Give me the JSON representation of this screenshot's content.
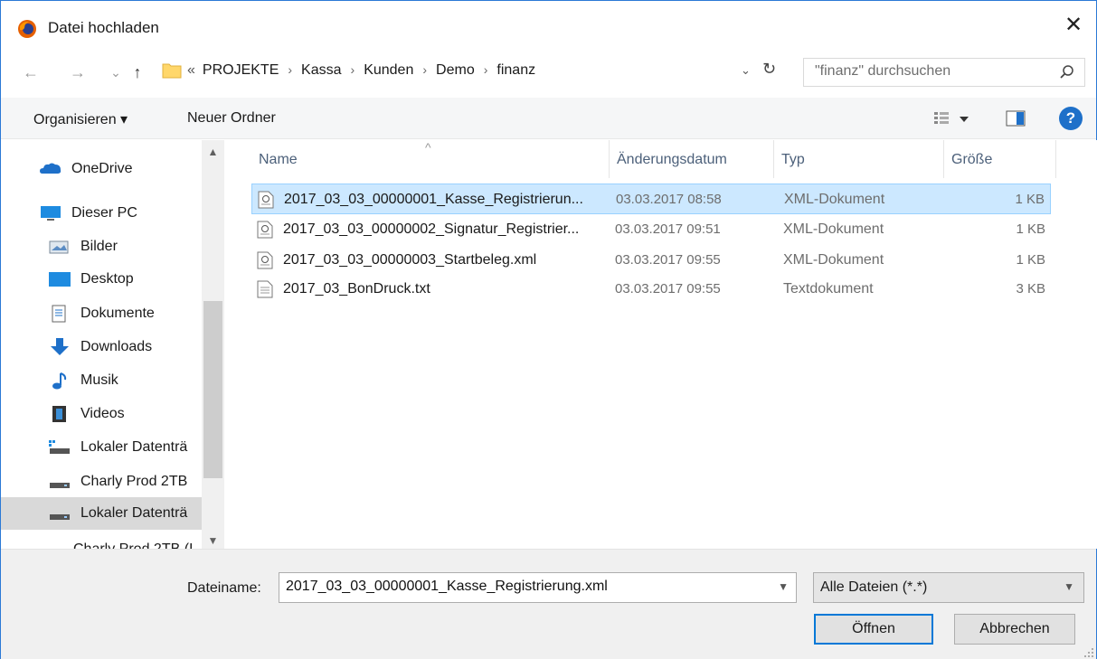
{
  "window": {
    "title": "Datei hochladen",
    "close_glyph": "✕",
    "app_icon": "firefox-icon"
  },
  "nav": {
    "back_glyph": "←",
    "forward_glyph": "→",
    "recent_glyph": "⌄",
    "up_glyph": "↑",
    "overflow_glyph": "«",
    "path": [
      "PROJEKTE",
      "Kassa",
      "Kunden",
      "Demo",
      "finanz"
    ],
    "path_sep": "›",
    "dropdown_glyph": "⌄",
    "refresh_glyph": "↻",
    "search_placeholder": "\"finanz\" durchsuchen"
  },
  "toolbar": {
    "organize_label": "Organisieren ▾",
    "new_folder_label": "Neuer Ordner",
    "help_label": "?"
  },
  "sidebar": {
    "items": [
      {
        "label": "OneDrive",
        "icon": "onedrive-icon"
      },
      {
        "label": "Dieser PC",
        "icon": "computer-icon"
      },
      {
        "label": "Bilder",
        "icon": "pictures-icon"
      },
      {
        "label": "Desktop",
        "icon": "desktop-icon"
      },
      {
        "label": "Dokumente",
        "icon": "documents-icon"
      },
      {
        "label": "Downloads",
        "icon": "downloads-icon"
      },
      {
        "label": "Musik",
        "icon": "music-icon"
      },
      {
        "label": "Videos",
        "icon": "videos-icon"
      },
      {
        "label": "Lokaler Datenträ",
        "icon": "drive-icon"
      },
      {
        "label": "Charly Prod 2TB",
        "icon": "drive-icon"
      },
      {
        "label": "Lokaler Datenträ",
        "icon": "drive-icon"
      },
      {
        "label": "Charly Prod 2TB (I",
        "icon": "drive-icon"
      }
    ]
  },
  "filelist": {
    "columns": [
      "Name",
      "Änderungsdatum",
      "Typ",
      "Größe"
    ],
    "rows": [
      {
        "name": "2017_03_03_00000001_Kasse_Registrierun...",
        "date": "03.03.2017 08:58",
        "type": "XML-Dokument",
        "size": "1 KB",
        "icon": "xml-file-icon"
      },
      {
        "name": "2017_03_03_00000002_Signatur_Registrier...",
        "date": "03.03.2017 09:51",
        "type": "XML-Dokument",
        "size": "1 KB",
        "icon": "xml-file-icon"
      },
      {
        "name": "2017_03_03_00000003_Startbeleg.xml",
        "date": "03.03.2017 09:55",
        "type": "XML-Dokument",
        "size": "1 KB",
        "icon": "xml-file-icon"
      },
      {
        "name": "2017_03_BonDruck.txt",
        "date": "03.03.2017 09:55",
        "type": "Textdokument",
        "size": "3 KB",
        "icon": "text-file-icon"
      }
    ]
  },
  "footer": {
    "filename_label": "Dateiname:",
    "filename_value": "2017_03_03_00000001_Kasse_Registrierung.xml",
    "filter_value": "Alle Dateien (*.*)",
    "open_label": "Öffnen",
    "cancel_label": "Abbrechen"
  },
  "colors": {
    "accent": "#0078d7",
    "selection": "#cce8ff",
    "header_text": "#4c607a"
  }
}
